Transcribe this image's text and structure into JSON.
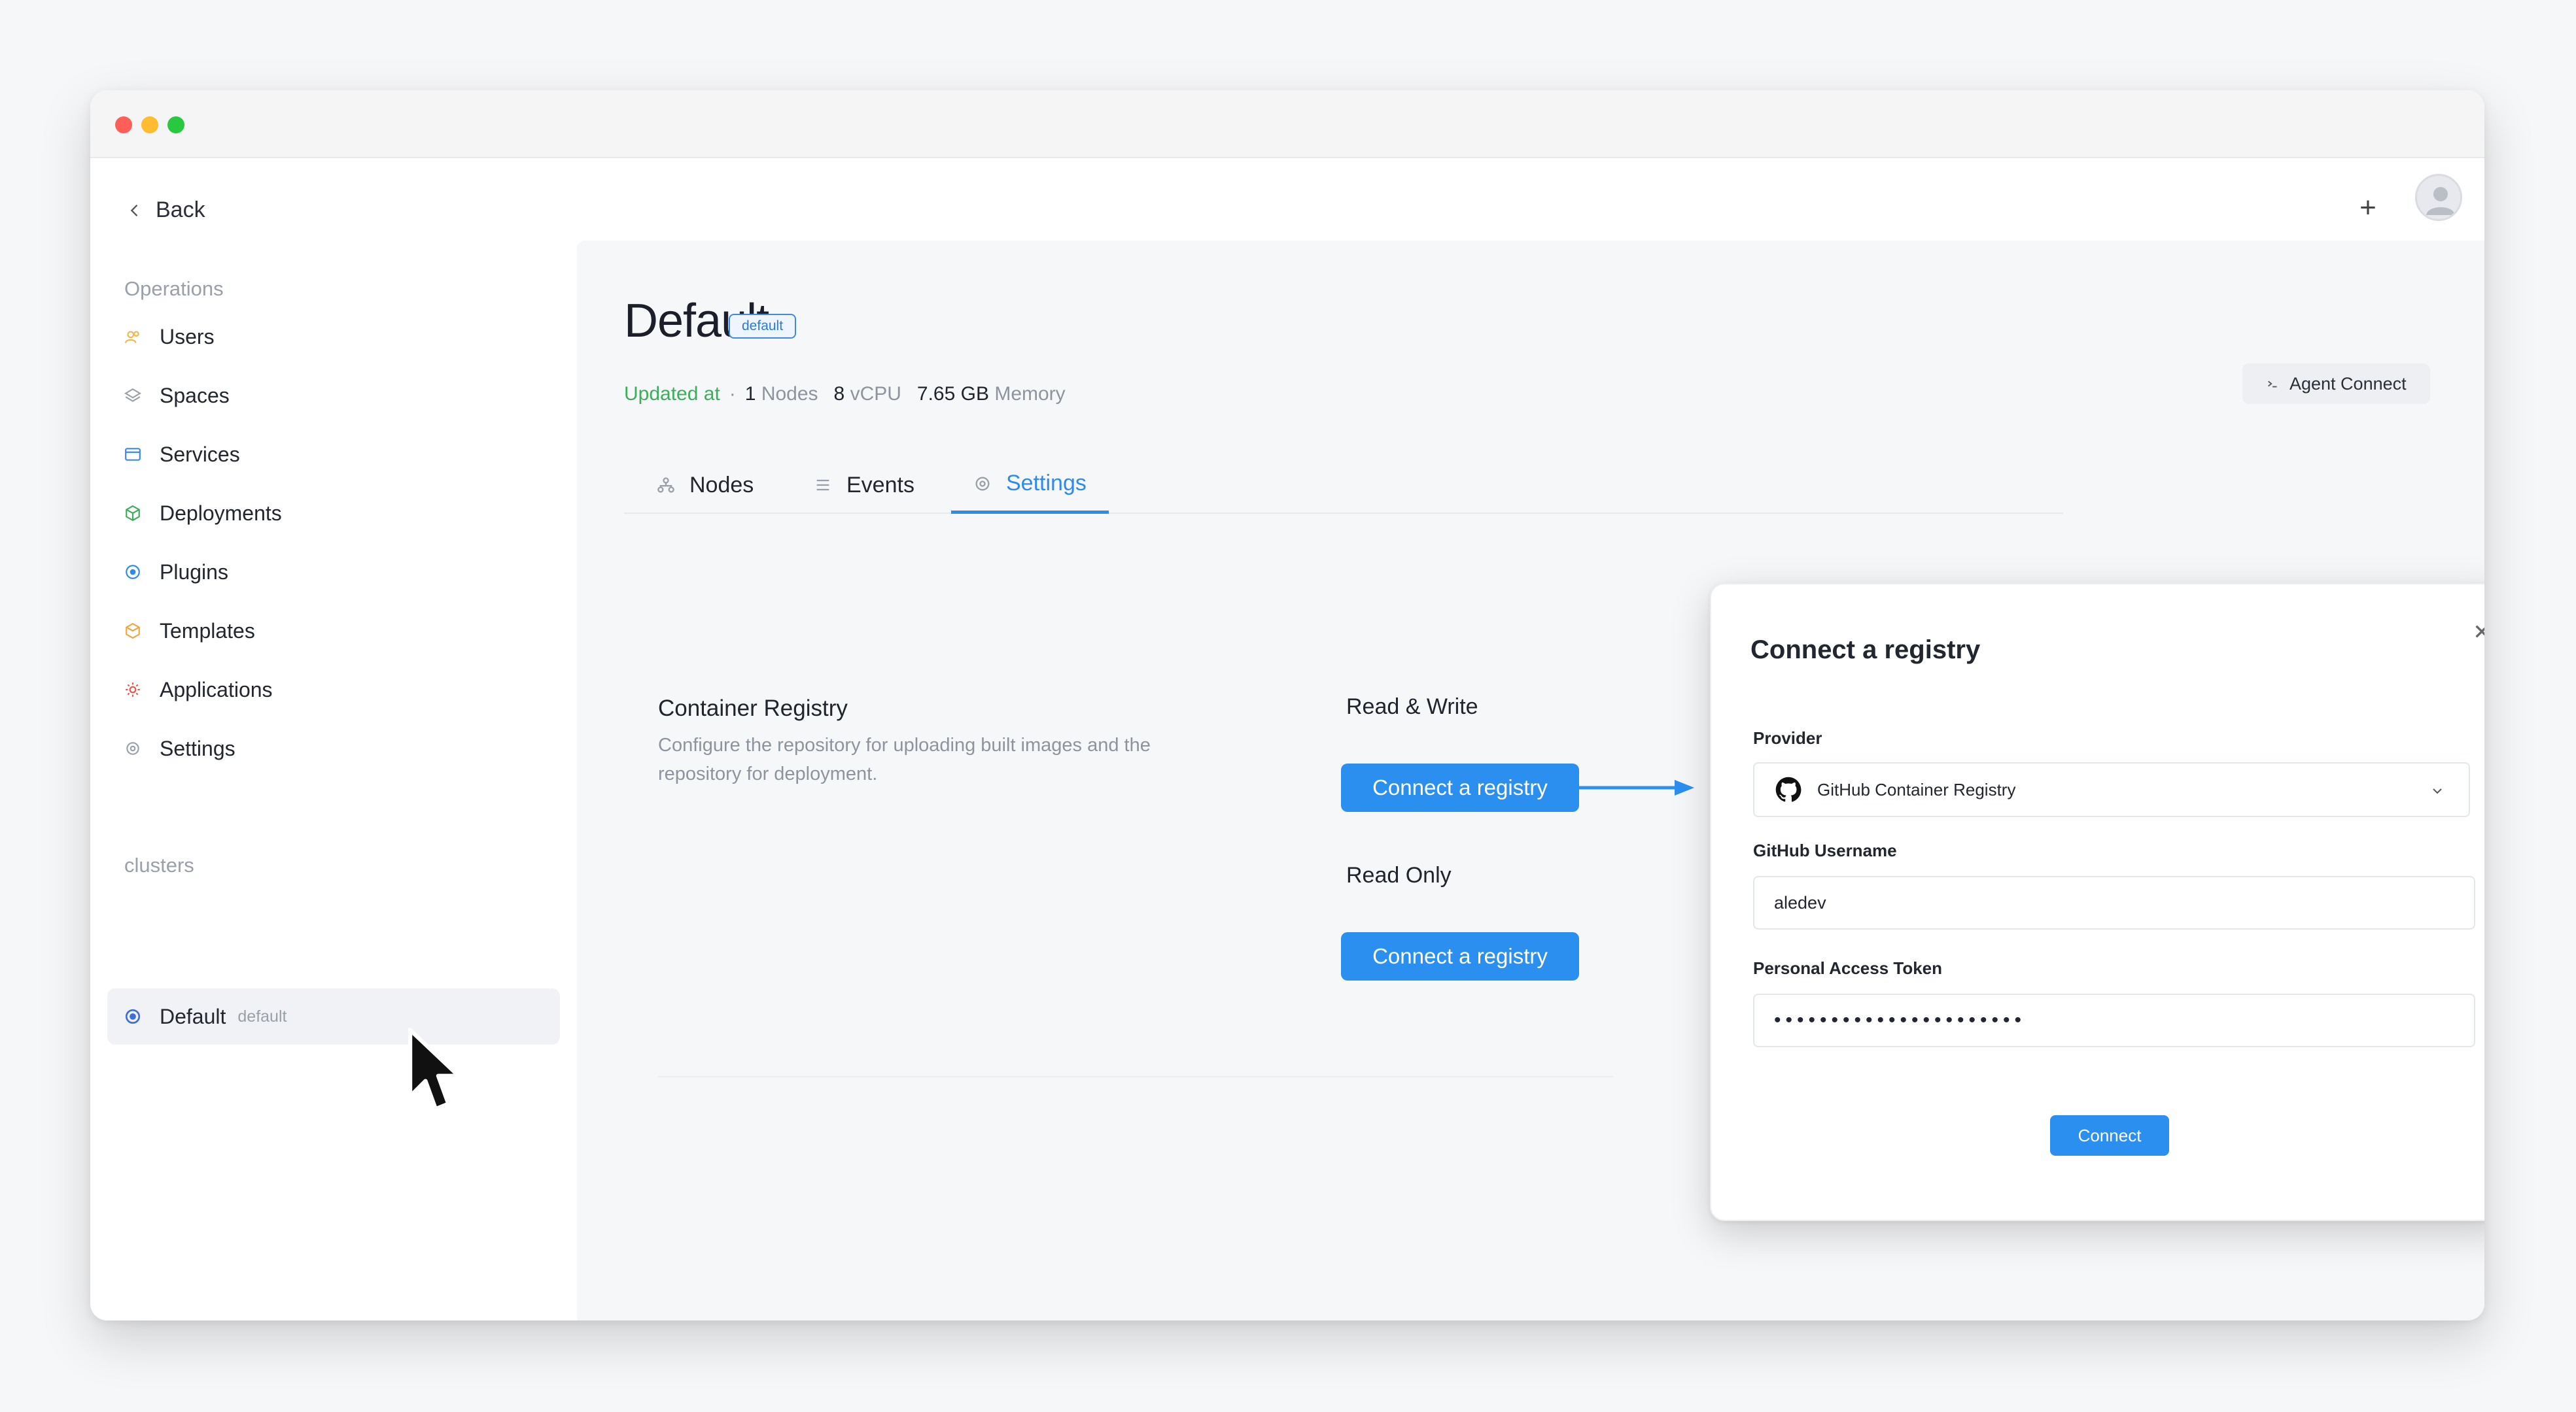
{
  "window": {
    "controls": {
      "close_color": "#ff5f57",
      "minimize_color": "#febc2e",
      "maximize_color": "#28c840"
    }
  },
  "sidebar": {
    "back_label": "Back",
    "operations_label": "Operations",
    "items": [
      {
        "label": "Users",
        "icon": "users-icon",
        "color": "#f2b84b"
      },
      {
        "label": "Spaces",
        "icon": "layers-icon",
        "color": "#9aa0aa"
      },
      {
        "label": "Services",
        "icon": "window-icon",
        "color": "#3f8ae0"
      },
      {
        "label": "Deployments",
        "icon": "cube-icon",
        "color": "#3cad5b"
      },
      {
        "label": "Plugins",
        "icon": "plugin-icon",
        "color": "#2f8ae8"
      },
      {
        "label": "Templates",
        "icon": "box-icon",
        "color": "#f0a640"
      },
      {
        "label": "Applications",
        "icon": "gear-icon",
        "color": "#e5574b"
      },
      {
        "label": "Settings",
        "icon": "settings-icon",
        "color": "#9aa0aa"
      }
    ],
    "clusters_label": "clusters",
    "cluster": {
      "name": "Default",
      "tag": "default",
      "icon": "cluster-icon",
      "color": "#3f6fd8"
    }
  },
  "header": {
    "plus_symbol": "+",
    "avatar_icon": "user-avatar-icon"
  },
  "main": {
    "title": "Default",
    "badge": "default",
    "meta": {
      "updated_label": "Updated at",
      "separator": "·",
      "nodes_count": "1",
      "nodes_label": "Nodes",
      "vcpu_count": "8",
      "vcpu_label": "vCPU",
      "memory_value": "7.65 GB",
      "memory_label": "Memory"
    },
    "agent_button": "Agent Connect",
    "tabs": [
      {
        "label": "Nodes",
        "icon": "nodes-icon",
        "active": false
      },
      {
        "label": "Events",
        "icon": "list-icon",
        "active": false
      },
      {
        "label": "Settings",
        "icon": "gear-icon",
        "active": true
      }
    ],
    "registry": {
      "title": "Container Registry",
      "description": "Configure the repository for uploading built images and the repository for deployment.",
      "read_write_label": "Read & Write",
      "read_only_label": "Read Only",
      "connect_label": "Connect a registry"
    }
  },
  "modal": {
    "title": "Connect a registry",
    "provider_label": "Provider",
    "provider_value": "GitHub Container Registry",
    "provider_icon": "github-icon",
    "username_label": "GitHub Username",
    "username_value": "aledev",
    "token_label": "Personal Access Token",
    "token_value": "••••••••••••••••••••••",
    "connect_button": "Connect"
  },
  "colors": {
    "accent": "#2b8ff0",
    "success": "#3cad5b",
    "text": "#20242c",
    "muted": "#8e949e"
  }
}
